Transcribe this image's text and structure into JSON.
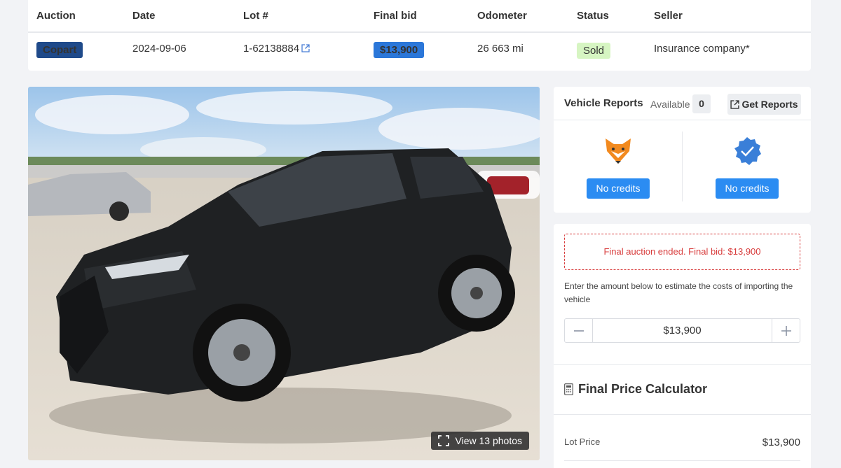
{
  "auction_table": {
    "headers": {
      "auction": "Auction",
      "date": "Date",
      "lot": "Lot #",
      "final_bid": "Final bid",
      "odometer": "Odometer",
      "status": "Status",
      "seller": "Seller"
    },
    "row": {
      "auction": "Copart",
      "date": "2024-09-06",
      "lot": "1-62138884",
      "final_bid": "$13,900",
      "odometer": "26 663 mi",
      "status": "Sold",
      "seller": "Insurance company*"
    },
    "colors": {
      "auction_badge": "#1f4a8a",
      "bid_badge": "#2b77d9",
      "sold_badge": "#d6f5c2"
    }
  },
  "photo": {
    "view_photos_label": "View 13 photos"
  },
  "vehicle_reports": {
    "title": "Vehicle Reports",
    "available_label": "Available",
    "available_count": "0",
    "get_reports_label": "Get Reports",
    "providers": [
      {
        "icon": "fox-icon",
        "button_label": "No credits"
      },
      {
        "icon": "check-badge-icon",
        "button_label": "No credits"
      }
    ]
  },
  "estimate": {
    "ended_message": "Final auction ended. Final bid: $13,900",
    "hint": "Enter the amount below to estimate the costs of importing the vehicle",
    "amount_value": "$13,900"
  },
  "calculator": {
    "title": "Final Price Calculator",
    "lot_price_label": "Lot Price",
    "lot_price_value": "$13,900"
  }
}
